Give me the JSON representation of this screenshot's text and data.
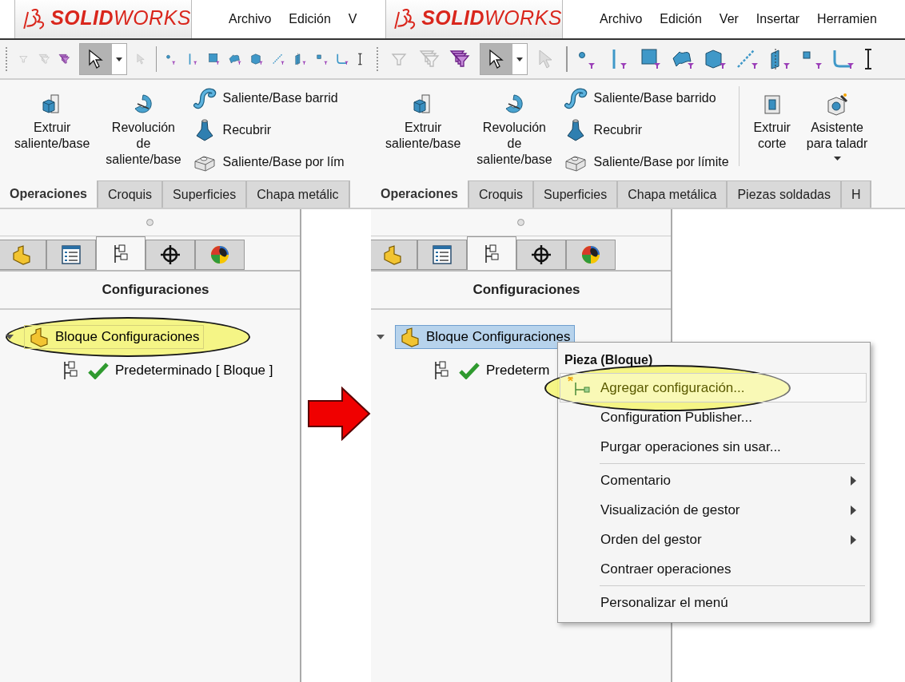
{
  "panels": [
    {
      "brand": "**SOLID**WORKS",
      "menu": [
        "Archivo",
        "Edición",
        "V"
      ],
      "select_tool": {
        "selected": true
      },
      "commands": [
        {
          "kind": "large",
          "label": "Extruir\nsaliente/base"
        },
        {
          "kind": "large",
          "label": "Revolución\nde\nsaliente/base"
        },
        {
          "kind": "stack",
          "items": [
            {
              "label": "Saliente/Base barrid"
            },
            {
              "label": "Recubrir"
            },
            {
              "label": "Saliente/Base por lím"
            }
          ]
        }
      ],
      "tabs": [
        {
          "label": "Operaciones",
          "selected": true
        },
        {
          "label": "Croquis",
          "selected": false
        },
        {
          "label": "Superficies",
          "selected": false
        },
        {
          "label": "Chapa metálic",
          "selected": false
        }
      ],
      "manager_tabs": [
        {
          "selected": false
        },
        {
          "selected": false
        },
        {
          "selected": true
        },
        {
          "selected": false
        },
        {
          "selected": false
        }
      ],
      "manager_title": "Configuraciones",
      "tree": [
        {
          "label": "Bloque Configuraciones",
          "expanded": true,
          "selected": false,
          "annotated": true,
          "children": [
            {
              "label": "Predeterminado [ Bloque ]",
              "active": true
            }
          ]
        }
      ]
    },
    {
      "brand": "**SOLID**WORKS",
      "menu": [
        "Archivo",
        "Edición",
        "Ver",
        "Insertar",
        "Herramien"
      ],
      "select_tool": {
        "selected": true
      },
      "commands": [
        {
          "kind": "large",
          "label": "Extruir\nsaliente/base"
        },
        {
          "kind": "large",
          "label": "Revolución\nde\nsaliente/base"
        },
        {
          "kind": "stack",
          "items": [
            {
              "label": "Saliente/Base barrido"
            },
            {
              "label": "Recubrir"
            },
            {
              "label": "Saliente/Base por límite"
            }
          ]
        },
        {
          "kind": "separator"
        },
        {
          "kind": "large",
          "label": "Extruir\ncorte"
        },
        {
          "kind": "large",
          "label": "Asistente\npara taladr",
          "dropdown": true
        }
      ],
      "tabs": [
        {
          "label": "Operaciones",
          "selected": true
        },
        {
          "label": "Croquis",
          "selected": false
        },
        {
          "label": "Superficies",
          "selected": false
        },
        {
          "label": "Chapa metálica",
          "selected": false
        },
        {
          "label": "Piezas soldadas",
          "selected": false
        },
        {
          "label": "H",
          "selected": false
        }
      ],
      "manager_tabs": [
        {
          "selected": false
        },
        {
          "selected": false
        },
        {
          "selected": true
        },
        {
          "selected": false
        },
        {
          "selected": false
        }
      ],
      "manager_title": "Configuraciones",
      "tree": [
        {
          "label": "Bloque Configuraciones",
          "expanded": true,
          "selected": true,
          "annotated": false,
          "children": [
            {
              "label": "Predeterm",
              "active": true
            }
          ]
        }
      ],
      "context_menu": {
        "title": "Pieza (Bloque)",
        "items": [
          {
            "kind": "item",
            "label": "Agregar configuración...",
            "icon": true,
            "selected": true,
            "annotated": true,
            "submenu": false
          },
          {
            "kind": "item",
            "label": "Configuration Publisher...",
            "icon": false,
            "selected": false,
            "annotated": false,
            "submenu": false
          },
          {
            "kind": "item",
            "label": "Purgar operaciones sin usar...",
            "icon": false,
            "selected": false,
            "annotated": false,
            "submenu": false
          },
          {
            "kind": "separator"
          },
          {
            "kind": "item",
            "label": "Comentario",
            "icon": false,
            "selected": false,
            "annotated": false,
            "submenu": true
          },
          {
            "kind": "item",
            "label": "Visualización de gestor",
            "icon": false,
            "selected": false,
            "annotated": false,
            "submenu": true
          },
          {
            "kind": "item",
            "label": "Orden del gestor",
            "icon": false,
            "selected": false,
            "annotated": false,
            "submenu": true
          },
          {
            "kind": "item",
            "label": "Contraer operaciones",
            "icon": false,
            "selected": false,
            "annotated": false,
            "submenu": false
          },
          {
            "kind": "separator"
          },
          {
            "kind": "item",
            "label": "Personalizar el menú",
            "icon": false,
            "selected": false,
            "annotated": false,
            "submenu": false
          }
        ]
      }
    }
  ]
}
